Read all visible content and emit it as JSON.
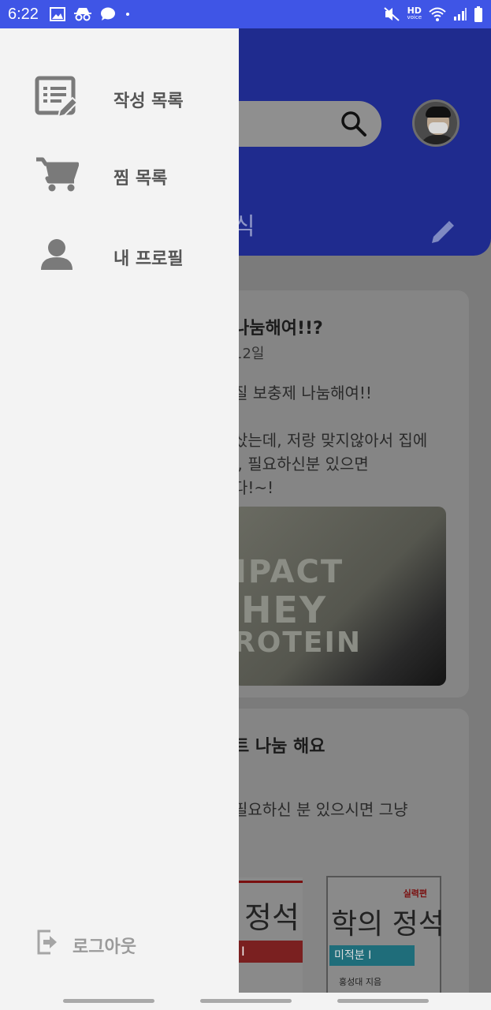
{
  "status_bar": {
    "time": "6:22",
    "left_icons": [
      "image-icon",
      "incognito-icon",
      "chat-bubble-icon",
      "dot-icon"
    ],
    "right_icons": [
      "mute-icon",
      "hd-voice-icon",
      "wifi-icon",
      "signal-icon",
      "battery-icon"
    ],
    "hd_label": "HD",
    "voice_label": "voice"
  },
  "drawer": {
    "items": [
      {
        "label": "작성 목록",
        "icon": "written-list-icon"
      },
      {
        "label": "찜 목록",
        "icon": "cart-icon"
      },
      {
        "label": "내 프로필",
        "icon": "person-icon"
      }
    ],
    "logout_label": "로그아웃"
  },
  "background_screen": {
    "header_partial_text": "식",
    "post1": {
      "title": "나눔해여!!?",
      "date": "12일",
      "body_line1": "질 보충제 나눔해여!!",
      "body_line2": "샀는데, 저랑 맞지않아서 집에",
      "body_line3": "l, 필요하신분 있으면",
      "body_line4": "다!~!",
      "photo_text_line1": "IPACT",
      "photo_text_line2": "HEY",
      "photo_text_line3": "ROTEIN"
    },
    "post2": {
      "title": "트 나눔 해요",
      "body": "필요하신 분 있으시면 그냥",
      "book1_title": "정석",
      "book1_bar": "I",
      "book2_badge": "실력편",
      "book2_title": "학의 정석",
      "book2_bar": "미적분 I",
      "book2_author": "홍성대 지음"
    }
  },
  "colors": {
    "status_bar": "#3f55e6",
    "header": "#1f2b8e",
    "drawer_bg": "#f3f3f3",
    "scrim": "#7b7b7b",
    "menu_text": "#555555",
    "logout_text": "#9a9a9a"
  }
}
